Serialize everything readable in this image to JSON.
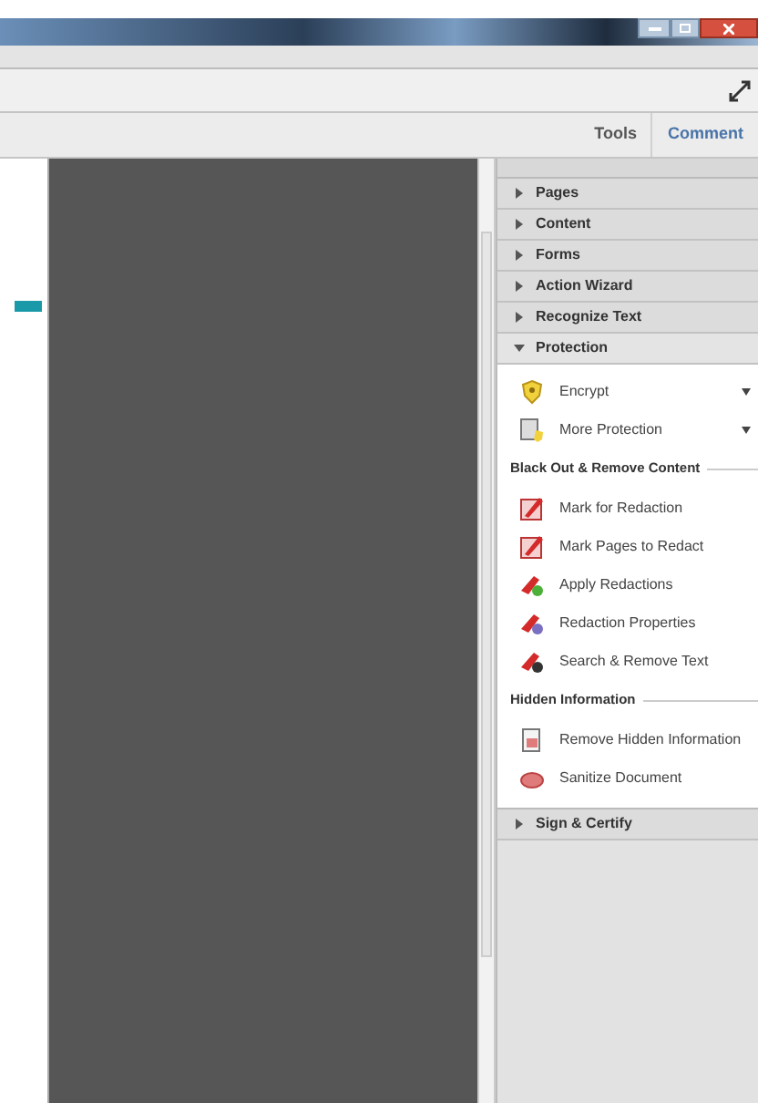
{
  "tabs": [
    {
      "label": "Tools"
    },
    {
      "label": "Comment"
    }
  ],
  "panels": [
    {
      "label": "Pages",
      "expanded": false
    },
    {
      "label": "Content",
      "expanded": false
    },
    {
      "label": "Forms",
      "expanded": false
    },
    {
      "label": "Action Wizard",
      "expanded": false
    },
    {
      "label": "Recognize Text",
      "expanded": false
    },
    {
      "label": "Protection",
      "expanded": true,
      "items": [
        {
          "label": "Encrypt",
          "has_menu": true
        },
        {
          "label": "More Protection",
          "has_menu": true
        }
      ],
      "sections": [
        {
          "title": "Black Out & Remove Content",
          "items": [
            {
              "label": "Mark for Redaction"
            },
            {
              "label": "Mark Pages to Redact"
            },
            {
              "label": "Apply Redactions"
            },
            {
              "label": "Redaction Properties"
            },
            {
              "label": "Search & Remove Text"
            }
          ]
        },
        {
          "title": "Hidden Information",
          "items": [
            {
              "label": "Remove Hidden Information"
            },
            {
              "label": "Sanitize Document"
            }
          ]
        }
      ]
    },
    {
      "label": "Sign & Certify",
      "expanded": false
    }
  ]
}
